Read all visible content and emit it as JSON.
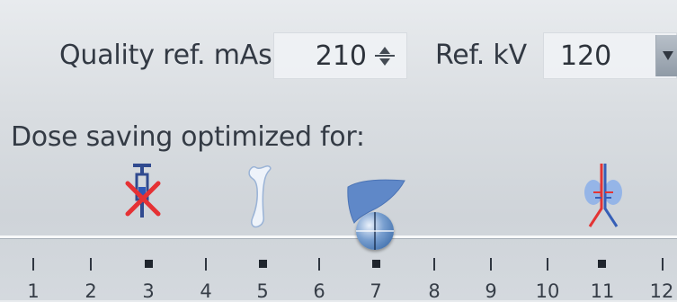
{
  "top": {
    "quality_label": "Quality ref. mAs",
    "quality_value": "210",
    "refkv_label": "Ref. kV",
    "refkv_value": "120"
  },
  "dose_saving_label": "Dose saving optimized for:",
  "slider": {
    "ticks": [
      {
        "label": "1",
        "major": false
      },
      {
        "label": "2",
        "major": false
      },
      {
        "label": "3",
        "major": true
      },
      {
        "label": "4",
        "major": false
      },
      {
        "label": "5",
        "major": true
      },
      {
        "label": "6",
        "major": false
      },
      {
        "label": "7",
        "major": true
      },
      {
        "label": "8",
        "major": false
      },
      {
        "label": "9",
        "major": false
      },
      {
        "label": "10",
        "major": false
      },
      {
        "label": "11",
        "major": true
      },
      {
        "label": "12",
        "major": false
      }
    ],
    "selected_value": "7"
  },
  "icons": {
    "contrast": "syringe-x-icon",
    "bone": "bone-icon",
    "soft_tissue": "liver-icon",
    "vascular": "vessel-icon"
  }
}
